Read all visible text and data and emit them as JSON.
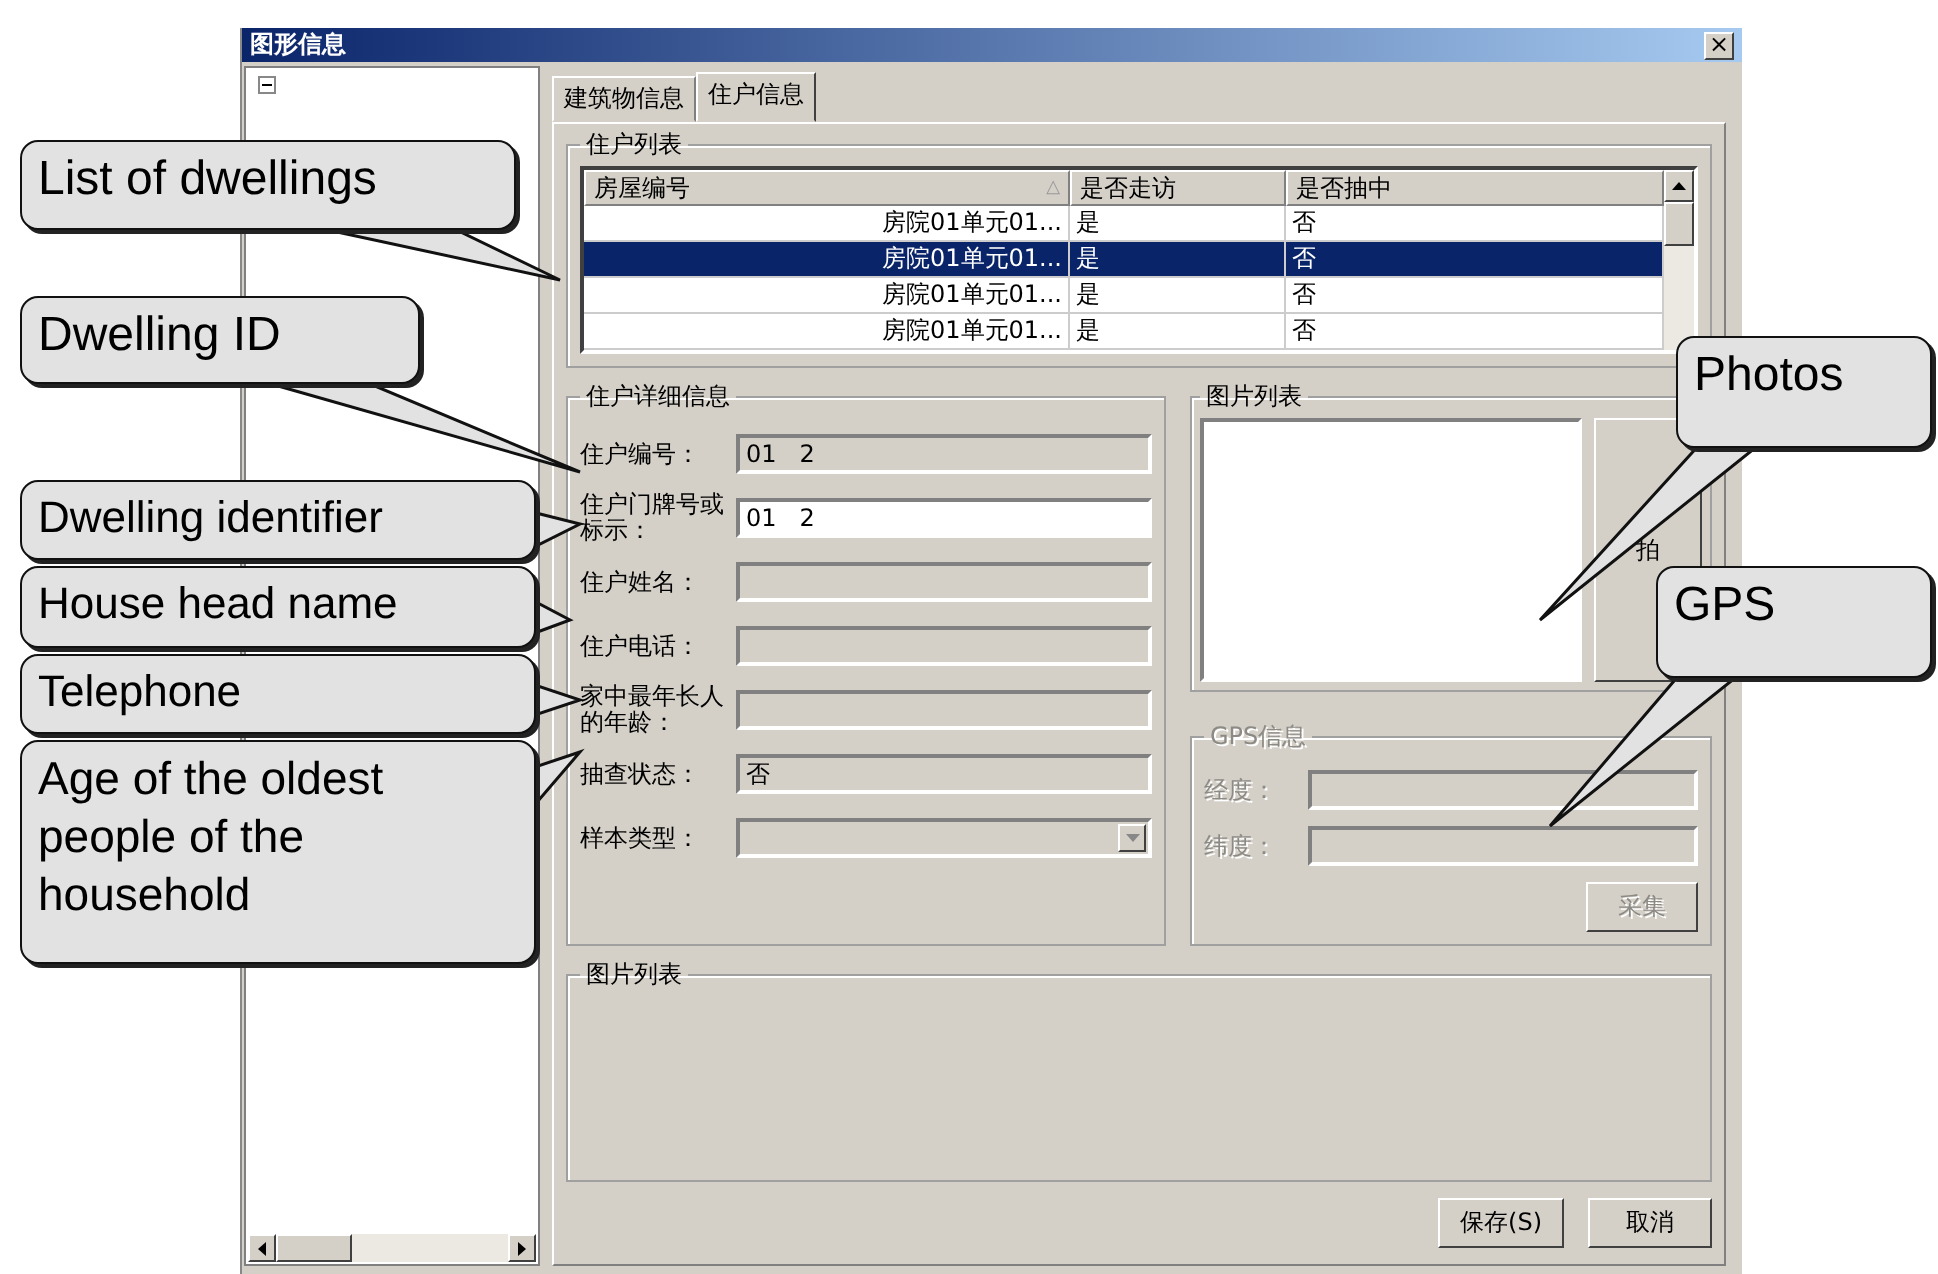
{
  "window": {
    "title": "图形信息",
    "close": "×"
  },
  "tabs": [
    {
      "label": "建筑物信息",
      "selected": false
    },
    {
      "label": "住户信息",
      "selected": true
    }
  ],
  "dwelling_list": {
    "title": "住户列表",
    "columns": [
      "房屋编号",
      "是否走访",
      "是否抽中"
    ],
    "sort_mark": "△",
    "rows": [
      {
        "cells": [
          "房院01单元01...",
          "是",
          "否"
        ],
        "selected": false
      },
      {
        "cells": [
          "房院01单元01...",
          "是",
          "否"
        ],
        "selected": true
      },
      {
        "cells": [
          "房院01单元01...",
          "是",
          "否"
        ],
        "selected": false
      },
      {
        "cells": [
          "房院01单元01...",
          "是",
          "否"
        ],
        "selected": false
      }
    ]
  },
  "details": {
    "title": "住户详细信息",
    "fields": [
      {
        "kind": "text",
        "label": "住户编号：",
        "value": "01   2",
        "editable": false
      },
      {
        "kind": "text",
        "label": "住户门牌号或标示：",
        "value": "01   2",
        "editable": true
      },
      {
        "kind": "text",
        "label": "住户姓名：",
        "editable": false
      },
      {
        "kind": "text",
        "label": "住户电话：",
        "editable": false
      },
      {
        "kind": "text",
        "label": "家中最年长人的年龄：",
        "editable": false
      },
      {
        "kind": "text",
        "label": "抽查状态：",
        "value": "否",
        "editable": false
      },
      {
        "kind": "combo",
        "label": "样本类型：",
        "editable": false
      }
    ]
  },
  "pictures": {
    "title": "图片列表",
    "button": "拍"
  },
  "gps": {
    "title": "GPS信息",
    "disabled": true,
    "fields": [
      "经度：",
      "纬度："
    ],
    "button": "采集"
  },
  "bottom_group": {
    "title": "图片列表"
  },
  "buttons": [
    "保存(S)",
    "取消"
  ],
  "callouts": [
    "List of dwellings",
    "Dwelling ID",
    "Dwelling identifier",
    "House head name",
    "Telephone",
    "Age of the oldest people  of the household",
    "Photos",
    "GPS"
  ]
}
